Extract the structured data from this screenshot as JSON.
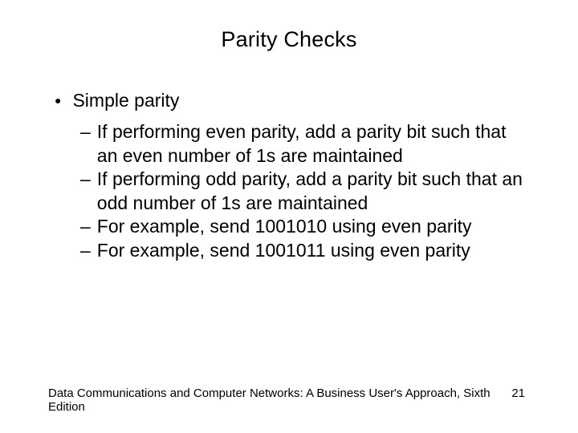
{
  "title": "Parity Checks",
  "heading": "Simple parity",
  "sub": [
    "If performing even parity, add a parity bit such that an even number of 1s are maintained",
    "If performing odd parity, add a parity bit such that an odd number of 1s are maintained",
    "For example, send 1001010 using even parity",
    "For example, send 1001011 using even parity"
  ],
  "footer_text": "Data Communications and Computer Networks: A Business User's Approach, Sixth Edition",
  "page_number": "21"
}
